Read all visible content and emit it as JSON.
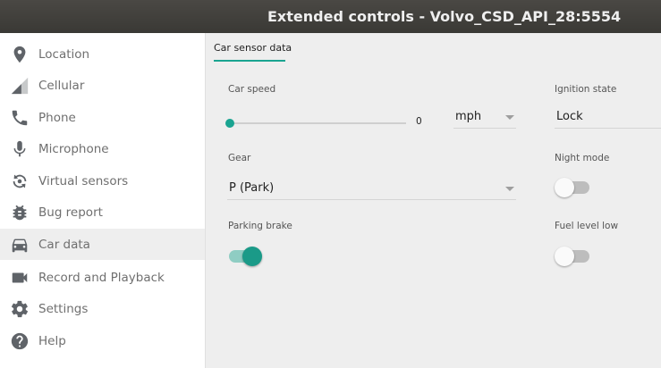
{
  "window": {
    "title": "Extended controls - Volvo_CSD_API_28:5554"
  },
  "sidebar": {
    "items": [
      {
        "label": "Location",
        "icon": "location-pin-icon"
      },
      {
        "label": "Cellular",
        "icon": "cellular-signal-icon"
      },
      {
        "label": "Phone",
        "icon": "phone-icon"
      },
      {
        "label": "Microphone",
        "icon": "microphone-icon"
      },
      {
        "label": "Virtual sensors",
        "icon": "rotation-sensor-icon"
      },
      {
        "label": "Bug report",
        "icon": "bug-icon"
      },
      {
        "label": "Car data",
        "icon": "car-icon",
        "selected": true
      },
      {
        "label": "Record and Playback",
        "icon": "video-camera-icon"
      },
      {
        "label": "Settings",
        "icon": "gear-icon"
      },
      {
        "label": "Help",
        "icon": "help-icon"
      }
    ]
  },
  "tabs": [
    {
      "label": "Car sensor data",
      "active": true
    }
  ],
  "car_speed": {
    "label": "Car speed",
    "value": "0",
    "slider_fraction": 0,
    "unit": "mph"
  },
  "ignition_state": {
    "label": "Ignition state",
    "value": "Lock"
  },
  "gear": {
    "label": "Gear",
    "value": "P (Park)"
  },
  "night_mode": {
    "label": "Night mode",
    "on": false
  },
  "parking_brake": {
    "label": "Parking brake",
    "on": true
  },
  "fuel_level_low": {
    "label": "Fuel level low",
    "on": false
  },
  "colors": {
    "accent": "#1aa491",
    "titlebar": "#3e3d39",
    "sidebar_bg": "#ffffff",
    "content_bg": "#eeeeee"
  }
}
